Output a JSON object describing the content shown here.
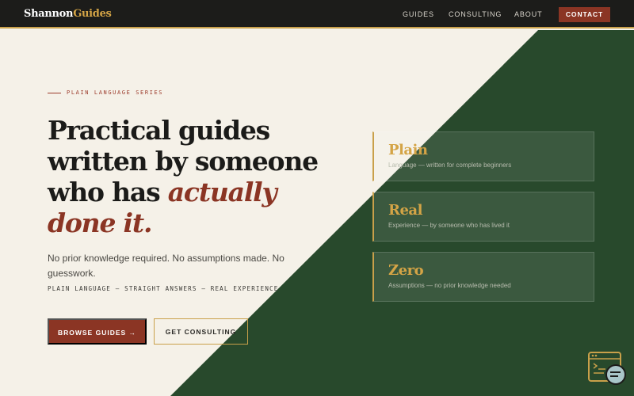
{
  "brand": {
    "name_first": "Shannon",
    "name_second": "Guides"
  },
  "nav": {
    "guides": "GUIDES",
    "consulting": "CONSULTING",
    "about": "ABOUT",
    "contact": "CONTACT"
  },
  "hero": {
    "eyebrow": "PLAIN LANGUAGE SERIES",
    "headline_line1": "Practical guides",
    "headline_line2": "written by someone",
    "headline_line3_prefix": "who has ",
    "headline_line3_emphasis": "actually",
    "headline_line4_emphasis": "done it.",
    "lede": "No prior knowledge required. No assumptions made. No guesswork.",
    "tagline": "PLAIN LANGUAGE — STRAIGHT ANSWERS — REAL EXPERIENCE",
    "primary_button": "BROWSE GUIDES →",
    "secondary_button": "GET CONSULTING"
  },
  "cards": [
    {
      "title": "Plain",
      "subtitle": "Language — written for complete beginners"
    },
    {
      "title": "Real",
      "subtitle": "Experience — by someone who has lived it"
    },
    {
      "title": "Zero",
      "subtitle": "Assumptions — no prior knowledge needed"
    }
  ],
  "colors": {
    "cream": "#f5f1e8",
    "forest": "#28492c",
    "rust": "#8b3524",
    "gold": "#d4a446",
    "charcoal": "#1c1c1a"
  },
  "icons": {
    "chat_widget": "terminal-chat-icon"
  }
}
